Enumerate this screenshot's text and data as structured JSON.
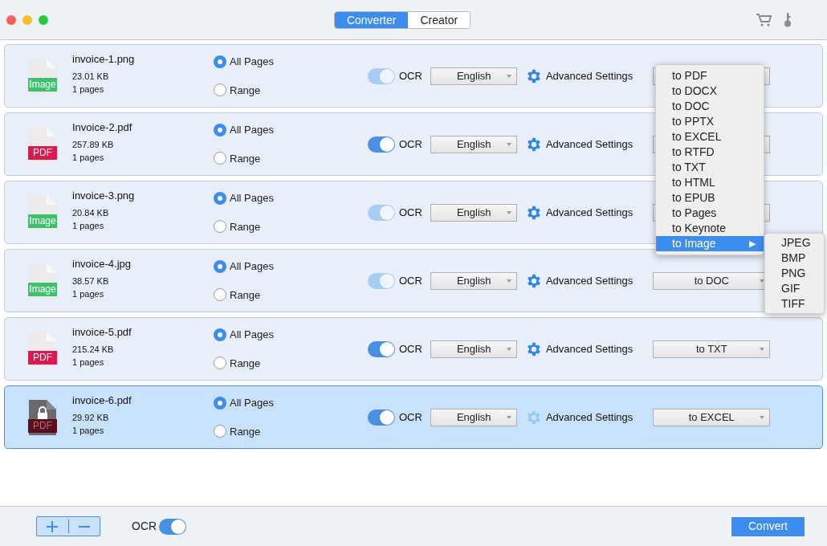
{
  "window": {
    "tabs": [
      {
        "label": "Converter",
        "selected": true
      },
      {
        "label": "Creator",
        "selected": false
      }
    ]
  },
  "files": [
    {
      "name": "invoice-1.png",
      "size": "23.01 KB",
      "pages": "1 pages",
      "badge": "Image",
      "kind": "image",
      "locked": false,
      "selected": false,
      "range_options": [
        {
          "label": "All Pages",
          "selected": true
        },
        {
          "label": "Range",
          "selected": false
        }
      ],
      "ocr": {
        "label": "OCR",
        "on": true,
        "disabled": true
      },
      "language": "English",
      "settings": "Advanced Settings",
      "settings_disabled": false
    },
    {
      "name": "Invoice-2.pdf",
      "size": "257.89 KB",
      "pages": "1 pages",
      "badge": "PDF",
      "kind": "pdf",
      "locked": false,
      "selected": false,
      "range_options": [
        {
          "label": "All Pages",
          "selected": true
        },
        {
          "label": "Range",
          "selected": false
        }
      ],
      "ocr": {
        "label": "OCR",
        "on": true,
        "disabled": false
      },
      "language": "English",
      "settings": "Advanced Settings",
      "settings_disabled": false
    },
    {
      "name": "invoice-3.png",
      "size": "20.84 KB",
      "pages": "1 pages",
      "badge": "Image",
      "kind": "image",
      "locked": false,
      "selected": false,
      "range_options": [
        {
          "label": "All Pages",
          "selected": true
        },
        {
          "label": "Range",
          "selected": false
        }
      ],
      "ocr": {
        "label": "OCR",
        "on": true,
        "disabled": true
      },
      "language": "English",
      "settings": "Advanced Settings",
      "settings_disabled": false
    },
    {
      "name": "invoice-4.jpg",
      "size": "38.57 KB",
      "pages": "1 pages",
      "badge": "Image",
      "kind": "image",
      "locked": false,
      "selected": false,
      "range_options": [
        {
          "label": "All Pages",
          "selected": true
        },
        {
          "label": "Range",
          "selected": false
        }
      ],
      "ocr": {
        "label": "OCR",
        "on": true,
        "disabled": true
      },
      "language": "English",
      "settings": "Advanced Settings",
      "settings_disabled": false,
      "format": "to DOC"
    },
    {
      "name": "invoice-5.pdf",
      "size": "215.24 KB",
      "pages": "1 pages",
      "badge": "PDF",
      "kind": "pdf",
      "locked": false,
      "selected": false,
      "range_options": [
        {
          "label": "All Pages",
          "selected": true
        },
        {
          "label": "Range",
          "selected": false
        }
      ],
      "ocr": {
        "label": "OCR",
        "on": true,
        "disabled": false
      },
      "language": "English",
      "settings": "Advanced Settings",
      "settings_disabled": false,
      "format": "to TXT"
    },
    {
      "name": "invoice-6.pdf",
      "size": "29.92 KB",
      "pages": "1 pages",
      "badge": "PDF",
      "kind": "pdf",
      "locked": true,
      "selected": true,
      "range_options": [
        {
          "label": "All Pages",
          "selected": true
        },
        {
          "label": "Range",
          "selected": false
        }
      ],
      "ocr": {
        "label": "OCR",
        "on": true,
        "disabled": false
      },
      "language": "English",
      "settings": "Advanced Settings",
      "settings_disabled": true,
      "format": "to EXCEL"
    }
  ],
  "format_menu": {
    "items": [
      {
        "label": "to PDF",
        "selected": false
      },
      {
        "label": "to DOCX",
        "selected": false
      },
      {
        "label": "to DOC",
        "selected": false
      },
      {
        "label": "to PPTX",
        "selected": false
      },
      {
        "label": "to EXCEL",
        "selected": false
      },
      {
        "label": "to RTFD",
        "selected": false
      },
      {
        "label": "to TXT",
        "selected": false
      },
      {
        "label": "to HTML",
        "selected": false
      },
      {
        "label": "to EPUB",
        "selected": false
      },
      {
        "label": "to Pages",
        "selected": false
      },
      {
        "label": "to Keynote",
        "selected": false
      },
      {
        "label": "to Image",
        "selected": true,
        "submenu_symbol": "▶"
      }
    ],
    "submenu": [
      "JPEG",
      "BMP",
      "PNG",
      "GIF",
      "TIFF"
    ]
  },
  "bottom_bar": {
    "ocr": {
      "label": "OCR",
      "on": true
    },
    "convert": "Convert"
  }
}
